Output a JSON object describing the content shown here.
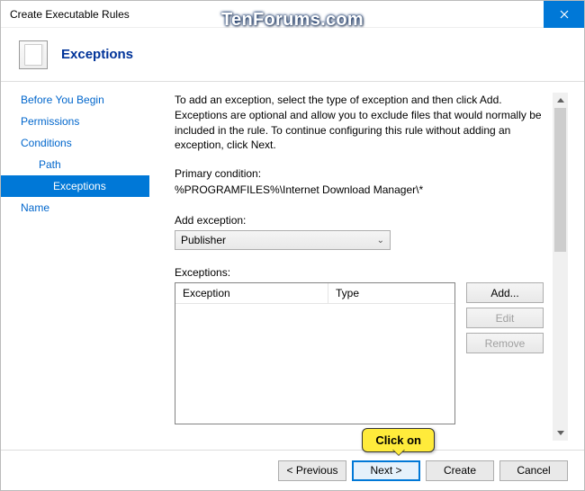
{
  "window": {
    "title": "Create Executable Rules"
  },
  "watermark": "TenForums.com",
  "header": {
    "title": "Exceptions"
  },
  "sidebar": {
    "items": [
      {
        "label": "Before You Begin",
        "level": "toplevel"
      },
      {
        "label": "Permissions",
        "level": "toplevel"
      },
      {
        "label": "Conditions",
        "level": "toplevel"
      },
      {
        "label": "Path",
        "level": "indent1"
      },
      {
        "label": "Exceptions",
        "level": "indent2",
        "selected": true
      },
      {
        "label": "Name",
        "level": "toplevel"
      }
    ]
  },
  "main": {
    "instructions": "To add an exception, select the type of exception and then click Add. Exceptions are optional and allow you to exclude files that would normally be included in the rule. To continue configuring this rule without adding an exception, click Next.",
    "primary_label": "Primary condition:",
    "primary_value": "%PROGRAMFILES%\\Internet Download Manager\\*",
    "add_label": "Add exception:",
    "add_value": "Publisher",
    "exceptions_label": "Exceptions:",
    "columns": {
      "c1": "Exception",
      "c2": "Type"
    },
    "buttons": {
      "add": "Add...",
      "edit": "Edit",
      "remove": "Remove"
    }
  },
  "footer": {
    "previous": "< Previous",
    "next": "Next >",
    "create": "Create",
    "cancel": "Cancel"
  },
  "callout": "Click on"
}
